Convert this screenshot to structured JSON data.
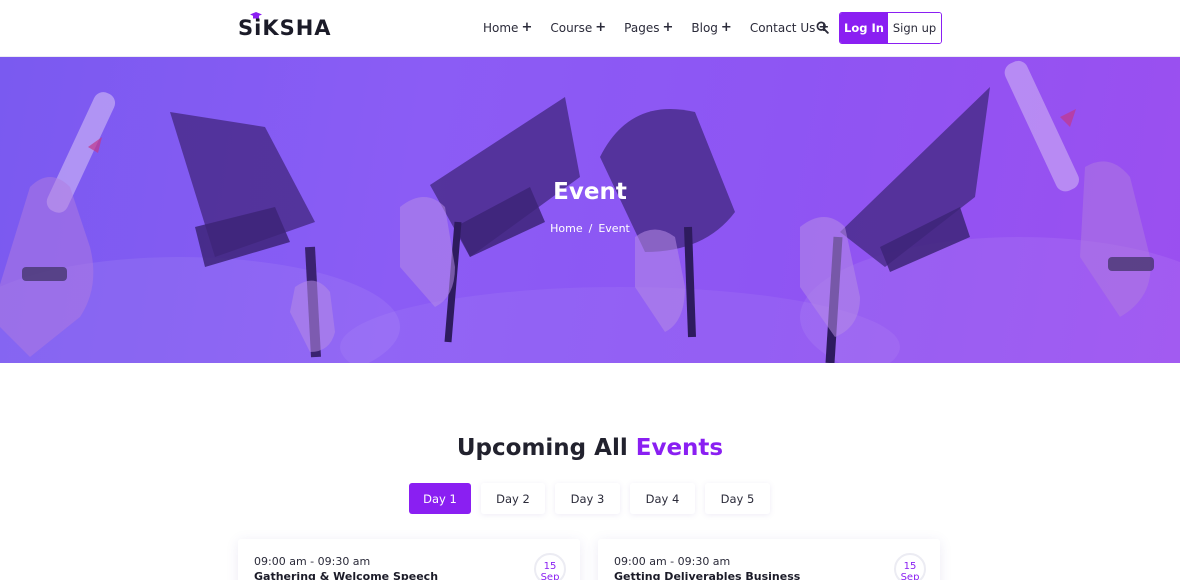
{
  "brand": {
    "logo_text": "SiKSHA",
    "accent": "#8a1ff2"
  },
  "nav": {
    "items": [
      {
        "label": "Home",
        "plus": "+"
      },
      {
        "label": "Course",
        "plus": "+"
      },
      {
        "label": "Pages",
        "plus": "+"
      },
      {
        "label": "Blog",
        "plus": "+"
      },
      {
        "label": "Contact Us",
        "plus": "+"
      }
    ],
    "search_icon": "search-icon",
    "login_label": "Log In",
    "signup_label": "Sign up"
  },
  "hero": {
    "title": "Event",
    "breadcrumb": {
      "home": "Home",
      "separator": "/",
      "current": "Event"
    },
    "overlay_color": "#8b5cf5"
  },
  "events": {
    "title_main": "Upcoming All",
    "title_accent": "Events",
    "tabs": [
      "Day 1",
      "Day 2",
      "Day 3",
      "Day 4",
      "Day 5"
    ],
    "active_tab": "Day 1",
    "cards": [
      {
        "time": "09:00 am - 09:30 am",
        "title": "Gathering & Welcome Speech",
        "day": "15",
        "month": "Sep"
      },
      {
        "time": "09:00 am - 09:30 am",
        "title": "Getting Deliverables Business",
        "day": "15",
        "month": "Sep"
      }
    ]
  }
}
